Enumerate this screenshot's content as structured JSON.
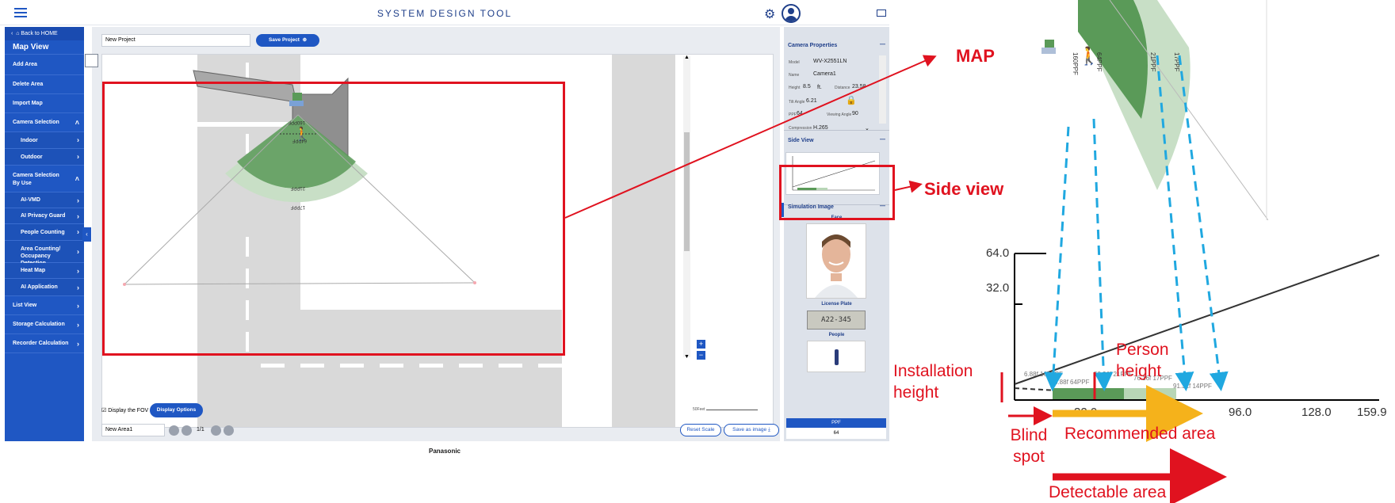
{
  "header": {
    "title": "SYSTEM DESIGN TOOL",
    "icons": [
      "menu-icon",
      "gear-icon",
      "user-icon",
      "mail-icon"
    ]
  },
  "sidebar": {
    "back_label": "Back to HOME",
    "section_title": "Map View",
    "items": [
      {
        "label": "Add Area"
      },
      {
        "label": "Delete Area"
      },
      {
        "label": "Import Map"
      },
      {
        "label": "Camera Selection"
      },
      {
        "label": "Indoor"
      },
      {
        "label": "Outdoor"
      },
      {
        "label": "Camera Selection By Use"
      },
      {
        "label": "AI-VMD"
      },
      {
        "label": "AI Privacy Guard"
      },
      {
        "label": "People Counting"
      },
      {
        "label": "Area Counting/ Occupancy Detection"
      },
      {
        "label": "Heat Map"
      },
      {
        "label": "AI Application"
      },
      {
        "label": "List View"
      },
      {
        "label": "Storage Calculation"
      },
      {
        "label": "Recorder Calculation"
      }
    ]
  },
  "toolbar": {
    "project_name": "New Project",
    "save_project": "Save Project"
  },
  "map": {
    "labels": [
      "160PPF",
      "64PPF",
      "21PPF",
      "17PPF"
    ],
    "display_fov_label": "Display the FOV",
    "display_options": "Display Options",
    "area_name": "New Area1",
    "page": "1/1",
    "reset_scale": "Reset Scale",
    "save_as_image": "Save as image",
    "scale_label": "50Feet"
  },
  "panel": {
    "camera_properties_title": "Camera Properties",
    "model_label": "Model",
    "model_value": "WV-X2551LN",
    "name_label": "Name",
    "name_value": "Camera1",
    "height_label": "Height",
    "height_value": "8.5",
    "height_unit": "ft.",
    "distance_label": "Distance",
    "distance_value": "23.58",
    "tilt_label": "Tilt Angle",
    "tilt_value": "6.21",
    "ppf_label": "PPF",
    "ppf_value": "64",
    "viewing_label": "Viewing Angle",
    "viewing_value": "90",
    "compression_label": "Compression",
    "compression_value": "H.265",
    "side_view_title": "Side View",
    "simulation_title": "Simulation Image",
    "face_label": "Face",
    "plate_label": "License Plate",
    "plate_text": "A22-345",
    "people_label": "People",
    "ppf_footer_label": "PPF",
    "ppf_footer_value": "64"
  },
  "footer": {
    "brand": "Panasonic"
  },
  "annotations": {
    "map_label": "MAP",
    "side_view_label": "Side view",
    "installation_height": "Installation height",
    "person_height": "Person height",
    "blind_spot": "Blind spot",
    "recommended_area": "Recommended area",
    "detectable_area": "Detectable area"
  },
  "zoom_map": {
    "labels": [
      "160PPF",
      "64PPF",
      "21PPF",
      "17PPF"
    ]
  },
  "zoom_chart": {
    "y_ticks": [
      "64.0",
      "32.0"
    ],
    "x_ticks": [
      "32.0",
      "64.0",
      "96.0",
      "128.0",
      "159.9"
    ],
    "point_labels": [
      "6.88f 160PPF",
      "5.88f 64PPF",
      "53.96f 21PPF",
      "76.16f 17PPF",
      "91.31f 14PPF"
    ]
  },
  "colors": {
    "brand_blue": "#1f57c3",
    "annotation_red": "#e0121f",
    "fov_green": "#5a9a58",
    "arrow_cyan": "#20a8e0",
    "arrow_orange": "#f5b21b"
  }
}
